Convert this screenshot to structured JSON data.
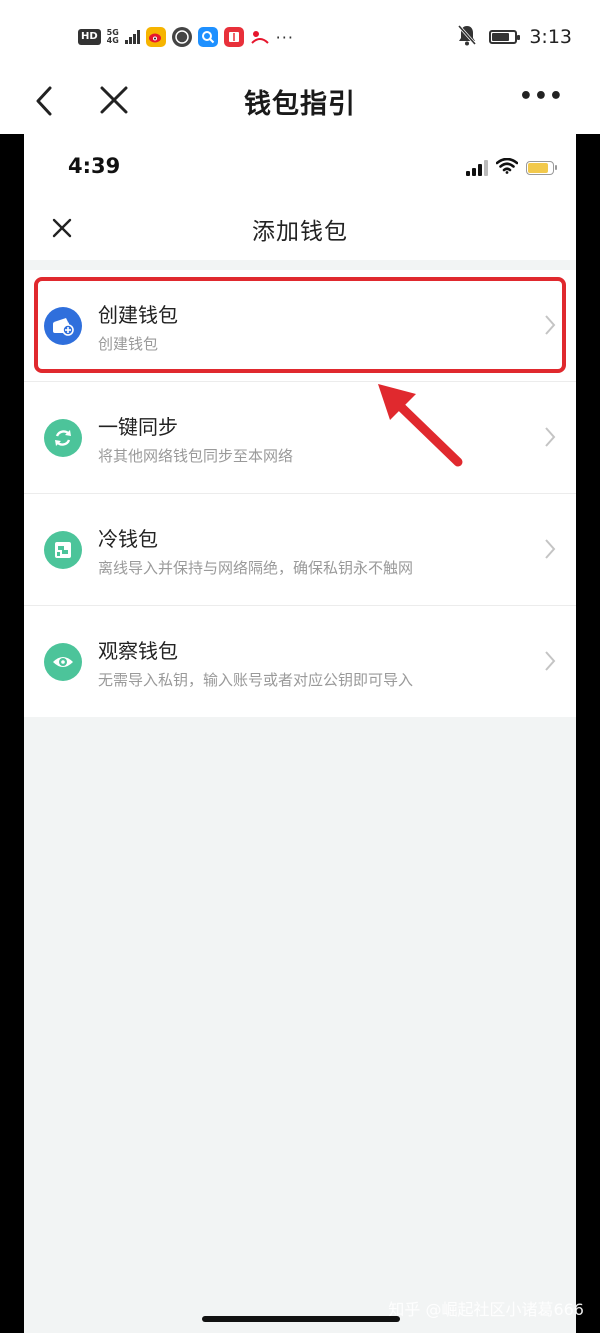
{
  "outer_status_bar": {
    "hd_badge": "HD",
    "network_badge": "5G",
    "network_sub": "4G",
    "more_indicator": "···",
    "time": "3:13"
  },
  "outer_nav": {
    "title": "钱包指引",
    "more": "•••"
  },
  "inner_status_bar": {
    "time": "4:39"
  },
  "inner_header": {
    "title": "添加钱包"
  },
  "wallet_options": [
    {
      "title": "创建钱包",
      "subtitle": "创建钱包",
      "icon": "wallet-plus-icon",
      "color": "#2f6fdc"
    },
    {
      "title": "一键同步",
      "subtitle": "将其他网络钱包同步至本网络",
      "icon": "sync-icon",
      "color": "#4cc49a"
    },
    {
      "title": "冷钱包",
      "subtitle": "离线导入并保持与网络隔绝，确保私钥永不触网",
      "icon": "cold-wallet-icon",
      "color": "#4cc49a"
    },
    {
      "title": "观察钱包",
      "subtitle": "无需导入私钥，输入账号或者对应公钥即可导入",
      "icon": "eye-icon",
      "color": "#4cc49a"
    }
  ],
  "annotation": {
    "highlight_color": "#e0292e"
  },
  "watermark": "知乎 @崛起社区小诸葛666"
}
